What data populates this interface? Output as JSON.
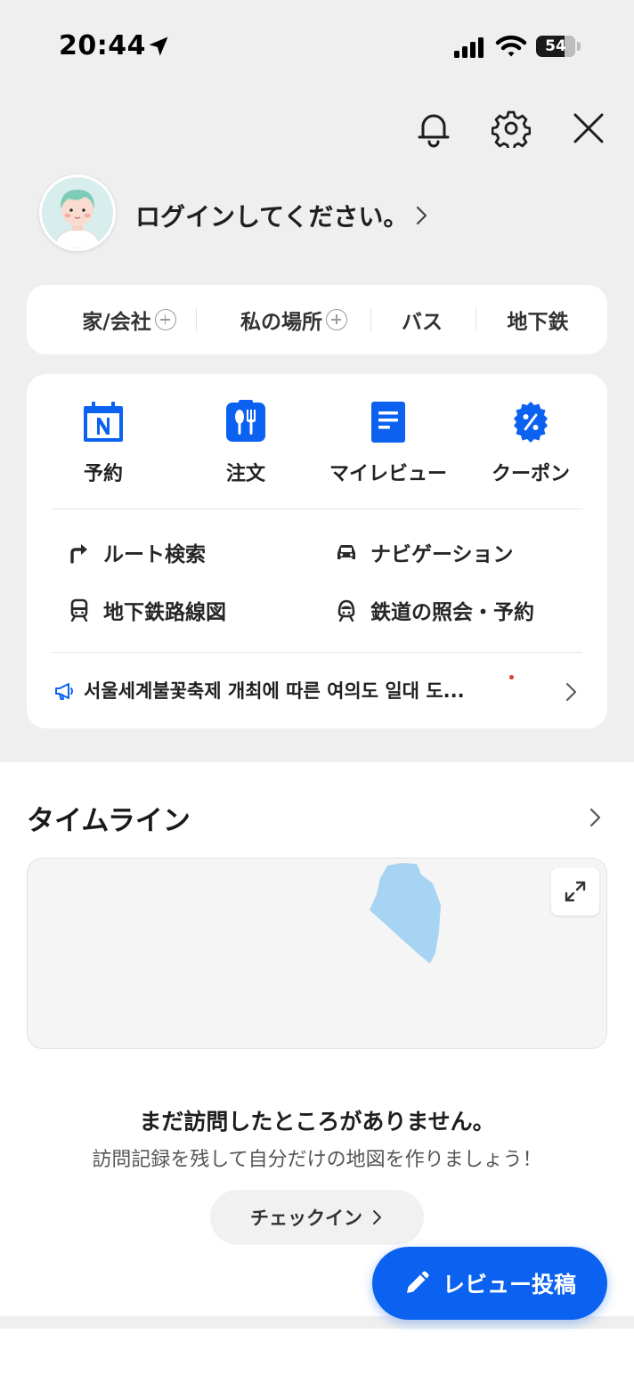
{
  "status_bar": {
    "time": "20:44",
    "battery": "54"
  },
  "profile": {
    "login_prompt": "ログインしてください。"
  },
  "quick_places": [
    {
      "label": "家/会社",
      "has_add": true
    },
    {
      "label": "私の場所",
      "has_add": true
    },
    {
      "label": "バス",
      "has_add": false
    },
    {
      "label": "地下鉄",
      "has_add": false
    }
  ],
  "services": [
    {
      "label": "予約",
      "icon": "calendar-n-icon"
    },
    {
      "label": "注文",
      "icon": "cutlery-icon"
    },
    {
      "label": "マイレビュー",
      "icon": "document-icon"
    },
    {
      "label": "クーポン",
      "icon": "percent-badge-icon"
    }
  ],
  "links": [
    {
      "label": "ルート検索",
      "icon": "turn-right-arrow-icon"
    },
    {
      "label": "ナビゲーション",
      "icon": "car-icon"
    },
    {
      "label": "地下鉄路線図",
      "icon": "subway-icon"
    },
    {
      "label": "鉄道の照会・予約",
      "icon": "train-icon"
    }
  ],
  "notice": {
    "text": "서울세계불꽃축제 개최에 따른 여의도 일대 도...",
    "icon": "megaphone-icon",
    "has_new": true
  },
  "timeline": {
    "title": "タイムライン",
    "empty_title": "まだ訪問したところがありません。",
    "empty_subtitle": "訪問記録を残して自分だけの地図を作りましょう！",
    "checkin_label": "チェックイン"
  },
  "fab": {
    "label": "レビュー投稿",
    "icon": "pencil-icon"
  },
  "colors": {
    "accent": "#0b62f0",
    "map_region": "#a8d4f4",
    "background": "#efefef"
  }
}
